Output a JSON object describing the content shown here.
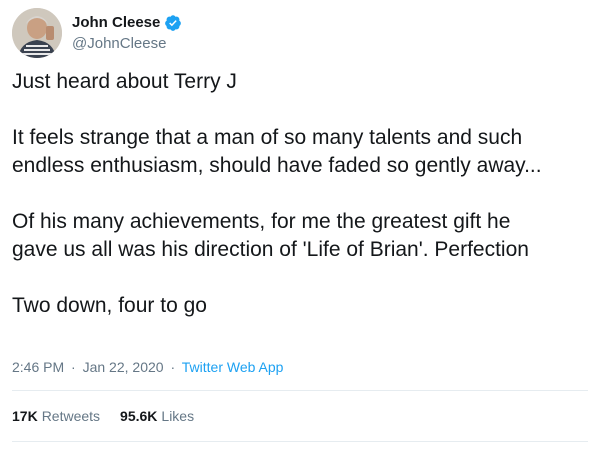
{
  "author": {
    "name": "John Cleese",
    "handle": "@JohnCleese",
    "verified_icon": "verified-badge-icon",
    "verified_color": "#1da1f2"
  },
  "tweet": {
    "lines": {
      "p1": "Just heard about Terry J",
      "p2a": "It feels strange that a man of so many talents and such",
      "p2b": "endless enthusiasm, should have faded so gently away...",
      "p3a": "Of his many achievements, for me the greatest gift he",
      "p3b": "gave us all was his direction of 'Life of Brian'. Perfection",
      "p4": "Two down, four to go"
    }
  },
  "meta": {
    "time": "2:46 PM",
    "separator": "·",
    "date": "Jan 22, 2020",
    "source": "Twitter Web App"
  },
  "stats": {
    "retweets_count": "17K",
    "retweets_label": "Retweets",
    "likes_count": "95.6K",
    "likes_label": "Likes"
  },
  "colors": {
    "text": "#14171a",
    "secondary": "#657786",
    "link": "#1da1f2",
    "divider": "#e6ecf0"
  }
}
